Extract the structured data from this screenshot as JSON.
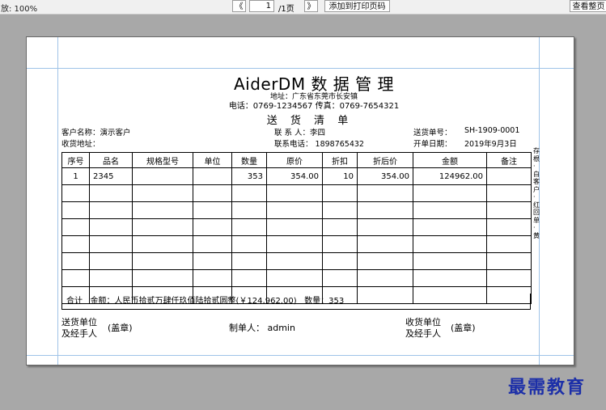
{
  "toolbar": {
    "zoom": "放: 100%",
    "first_page": "《",
    "page_value": "1",
    "page_total": "/1页",
    "next_page": "》",
    "add_to_print": "添加到打印页码",
    "view_full": "查看整页"
  },
  "document": {
    "company": "AiderDM 数 据 管 理",
    "address": "地址：广东省东莞市长安镇",
    "phone_fax": "电话：0769-1234567  传真：0769-7654321",
    "title": "送 货 清 单",
    "customer_name": "客户名称：演示客户",
    "ship_address": "收货地址：",
    "contact": "联  系  人：李四",
    "contact_phone": "联系电话：  1898765432",
    "order_no_label": "送货单号：",
    "order_no": "SH-1909-0001",
    "date_label": "开单日期：",
    "date": "2019年9月3日",
    "columns": [
      "序号",
      "品名",
      "规格型号",
      "单位",
      "数量",
      "原价",
      "折扣",
      "折后价",
      "金额",
      "备注"
    ],
    "rows": [
      [
        "1",
        "2345",
        "",
        "",
        "353",
        "354.00",
        "10",
        "354.00",
        "124962.00",
        ""
      ],
      [
        "",
        "",
        "",
        "",
        "",
        "",
        "",
        "",
        "",
        ""
      ],
      [
        "",
        "",
        "",
        "",
        "",
        "",
        "",
        "",
        "",
        ""
      ],
      [
        "",
        "",
        "",
        "",
        "",
        "",
        "",
        "",
        "",
        ""
      ],
      [
        "",
        "",
        "",
        "",
        "",
        "",
        "",
        "",
        "",
        ""
      ],
      [
        "",
        "",
        "",
        "",
        "",
        "",
        "",
        "",
        "",
        ""
      ],
      [
        "",
        "",
        "",
        "",
        "",
        "",
        "",
        "",
        "",
        ""
      ],
      [
        "",
        "",
        "",
        "",
        "",
        "",
        "",
        "",
        "",
        ""
      ]
    ],
    "total_label": "合计",
    "total_amount": "金额：人民币拾贰万肆仟玖佰陆拾贰圆整(￥124,962.00)",
    "total_qty": "数量：353",
    "sender_label_1": "送货单位",
    "sender_label_2": "及经手人",
    "seal_1": "(盖章)",
    "maker": "制单人：  admin",
    "receiver_label_1": "收货单位",
    "receiver_label_2": "及经手人",
    "seal_2": "(盖章)",
    "side_copies": "存根·白  客户·红  回单·黄"
  },
  "watermark": "最需教育"
}
